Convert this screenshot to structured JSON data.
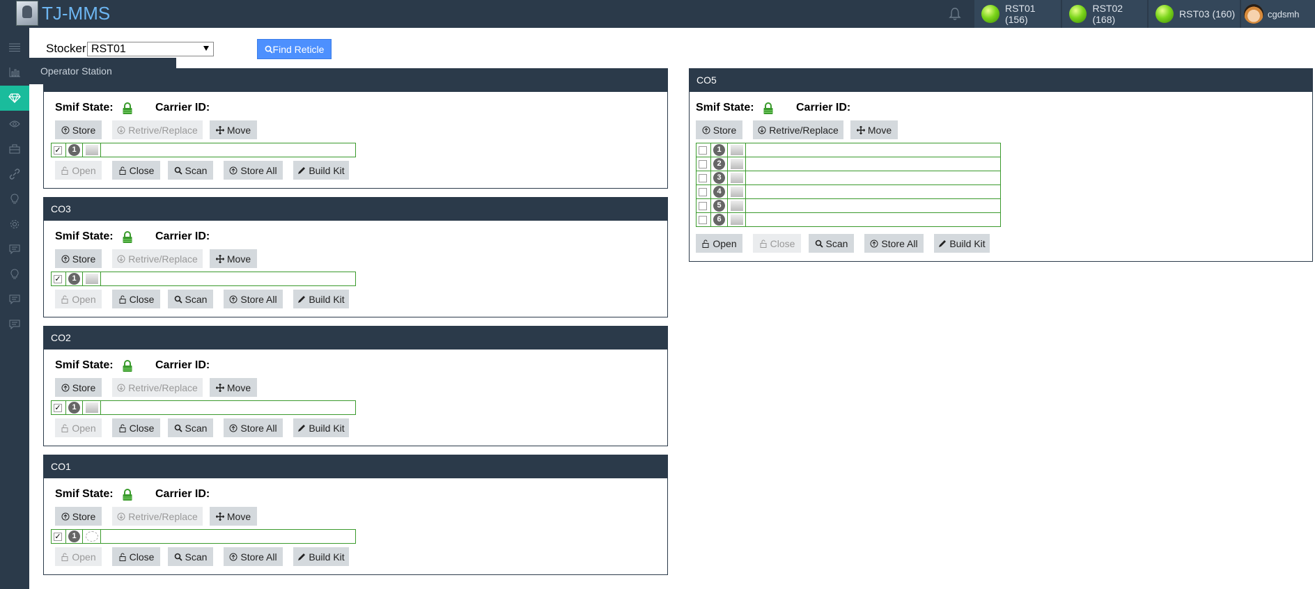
{
  "app": {
    "title": "TJ-MMS"
  },
  "header": {
    "stations": [
      {
        "label": "RST01 (156)",
        "status_color": "#7cd61c"
      },
      {
        "label": "RST02 (168)",
        "status_color": "#7cd61c"
      },
      {
        "label": "RST03 (160)",
        "status_color": "#7cd61c"
      }
    ],
    "user": {
      "name": "cgdsmh"
    }
  },
  "sidebar": {
    "items": [
      "menu-icon",
      "chart-icon",
      "diamond-icon",
      "eye-icon",
      "briefcase-icon",
      "link-icon",
      "bulb-icon",
      "gear-icon",
      "comment-icon",
      "bulb-icon",
      "comment-icon",
      "comment-icon"
    ],
    "active_index": 2,
    "flyout_label": "Operator Station"
  },
  "toolbar": {
    "stocker_label": "Stocker",
    "stocker_value": "RST01",
    "find_label": "Find Reticle"
  },
  "labels": {
    "smif_state": "Smif State:",
    "carrier_id": "Carrier ID:",
    "store": "Store",
    "retrive_replace": "Retrive/Replace",
    "move": "Move",
    "open": "Open",
    "close": "Close",
    "scan": "Scan",
    "store_all": "Store All",
    "build_kit": "Build Kit"
  },
  "panels": [
    {
      "title": "",
      "slots": [
        "1"
      ]
    },
    {
      "title": "CO3",
      "slots": [
        "1"
      ]
    },
    {
      "title": "CO2",
      "slots": [
        "1"
      ]
    },
    {
      "title": "CO1",
      "slots": [
        "1"
      ]
    },
    {
      "title": "CO5",
      "slots": [
        "1",
        "2",
        "3",
        "4",
        "5",
        "6"
      ]
    }
  ]
}
